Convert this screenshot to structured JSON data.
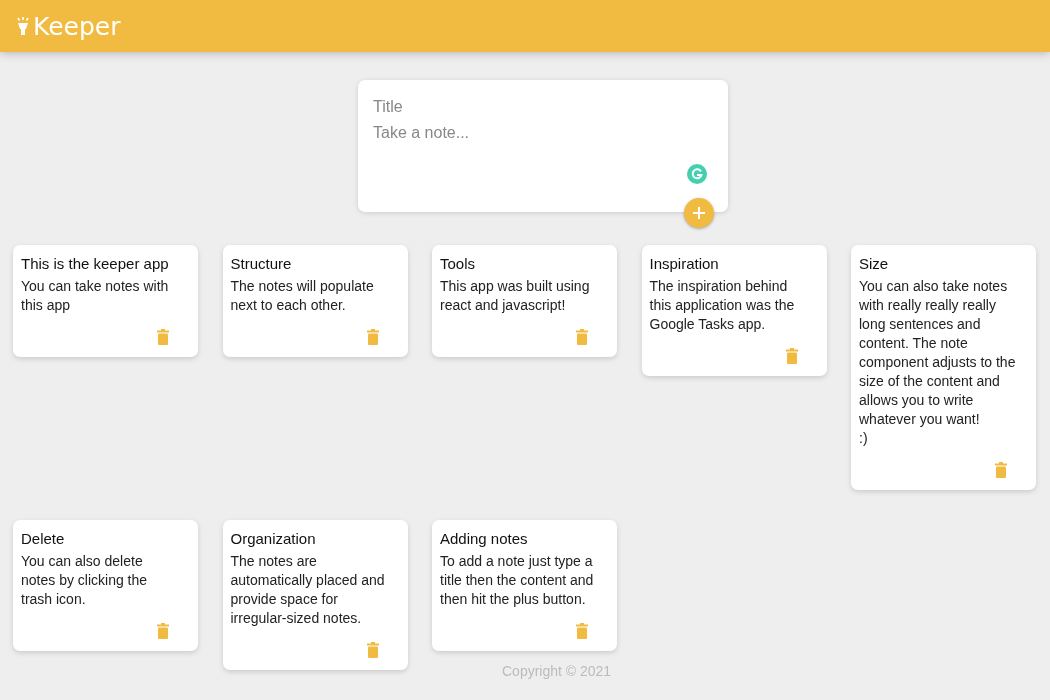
{
  "header": {
    "title": "Keeper"
  },
  "create_note": {
    "title_placeholder": "Title",
    "content_placeholder": "Take a note..."
  },
  "notes": [
    {
      "title": "This is the keeper app",
      "content": "You can take notes with this app"
    },
    {
      "title": "Structure",
      "content": "The notes will populate next to each other."
    },
    {
      "title": "Tools",
      "content": "This app was built using react and javascript!"
    },
    {
      "title": "Inspiration",
      "content": "The inspiration behind this application was the Google Tasks app."
    },
    {
      "title": "Size",
      "content": "You can also take notes with really really really long sentences and content. The note component adjusts to the size of the content and allows you to write whatever you want!\n:)"
    },
    {
      "title": "Delete",
      "content": "You can also delete notes by clicking the trash icon."
    },
    {
      "title": "Organization",
      "content": "The notes are automatically placed and provide space for irregular-sized notes."
    },
    {
      "title": "Adding notes",
      "content": "To add a note just type a title then the content and then hit the plus button."
    }
  ],
  "footer": {
    "copyright": "Copyright © 2021"
  }
}
